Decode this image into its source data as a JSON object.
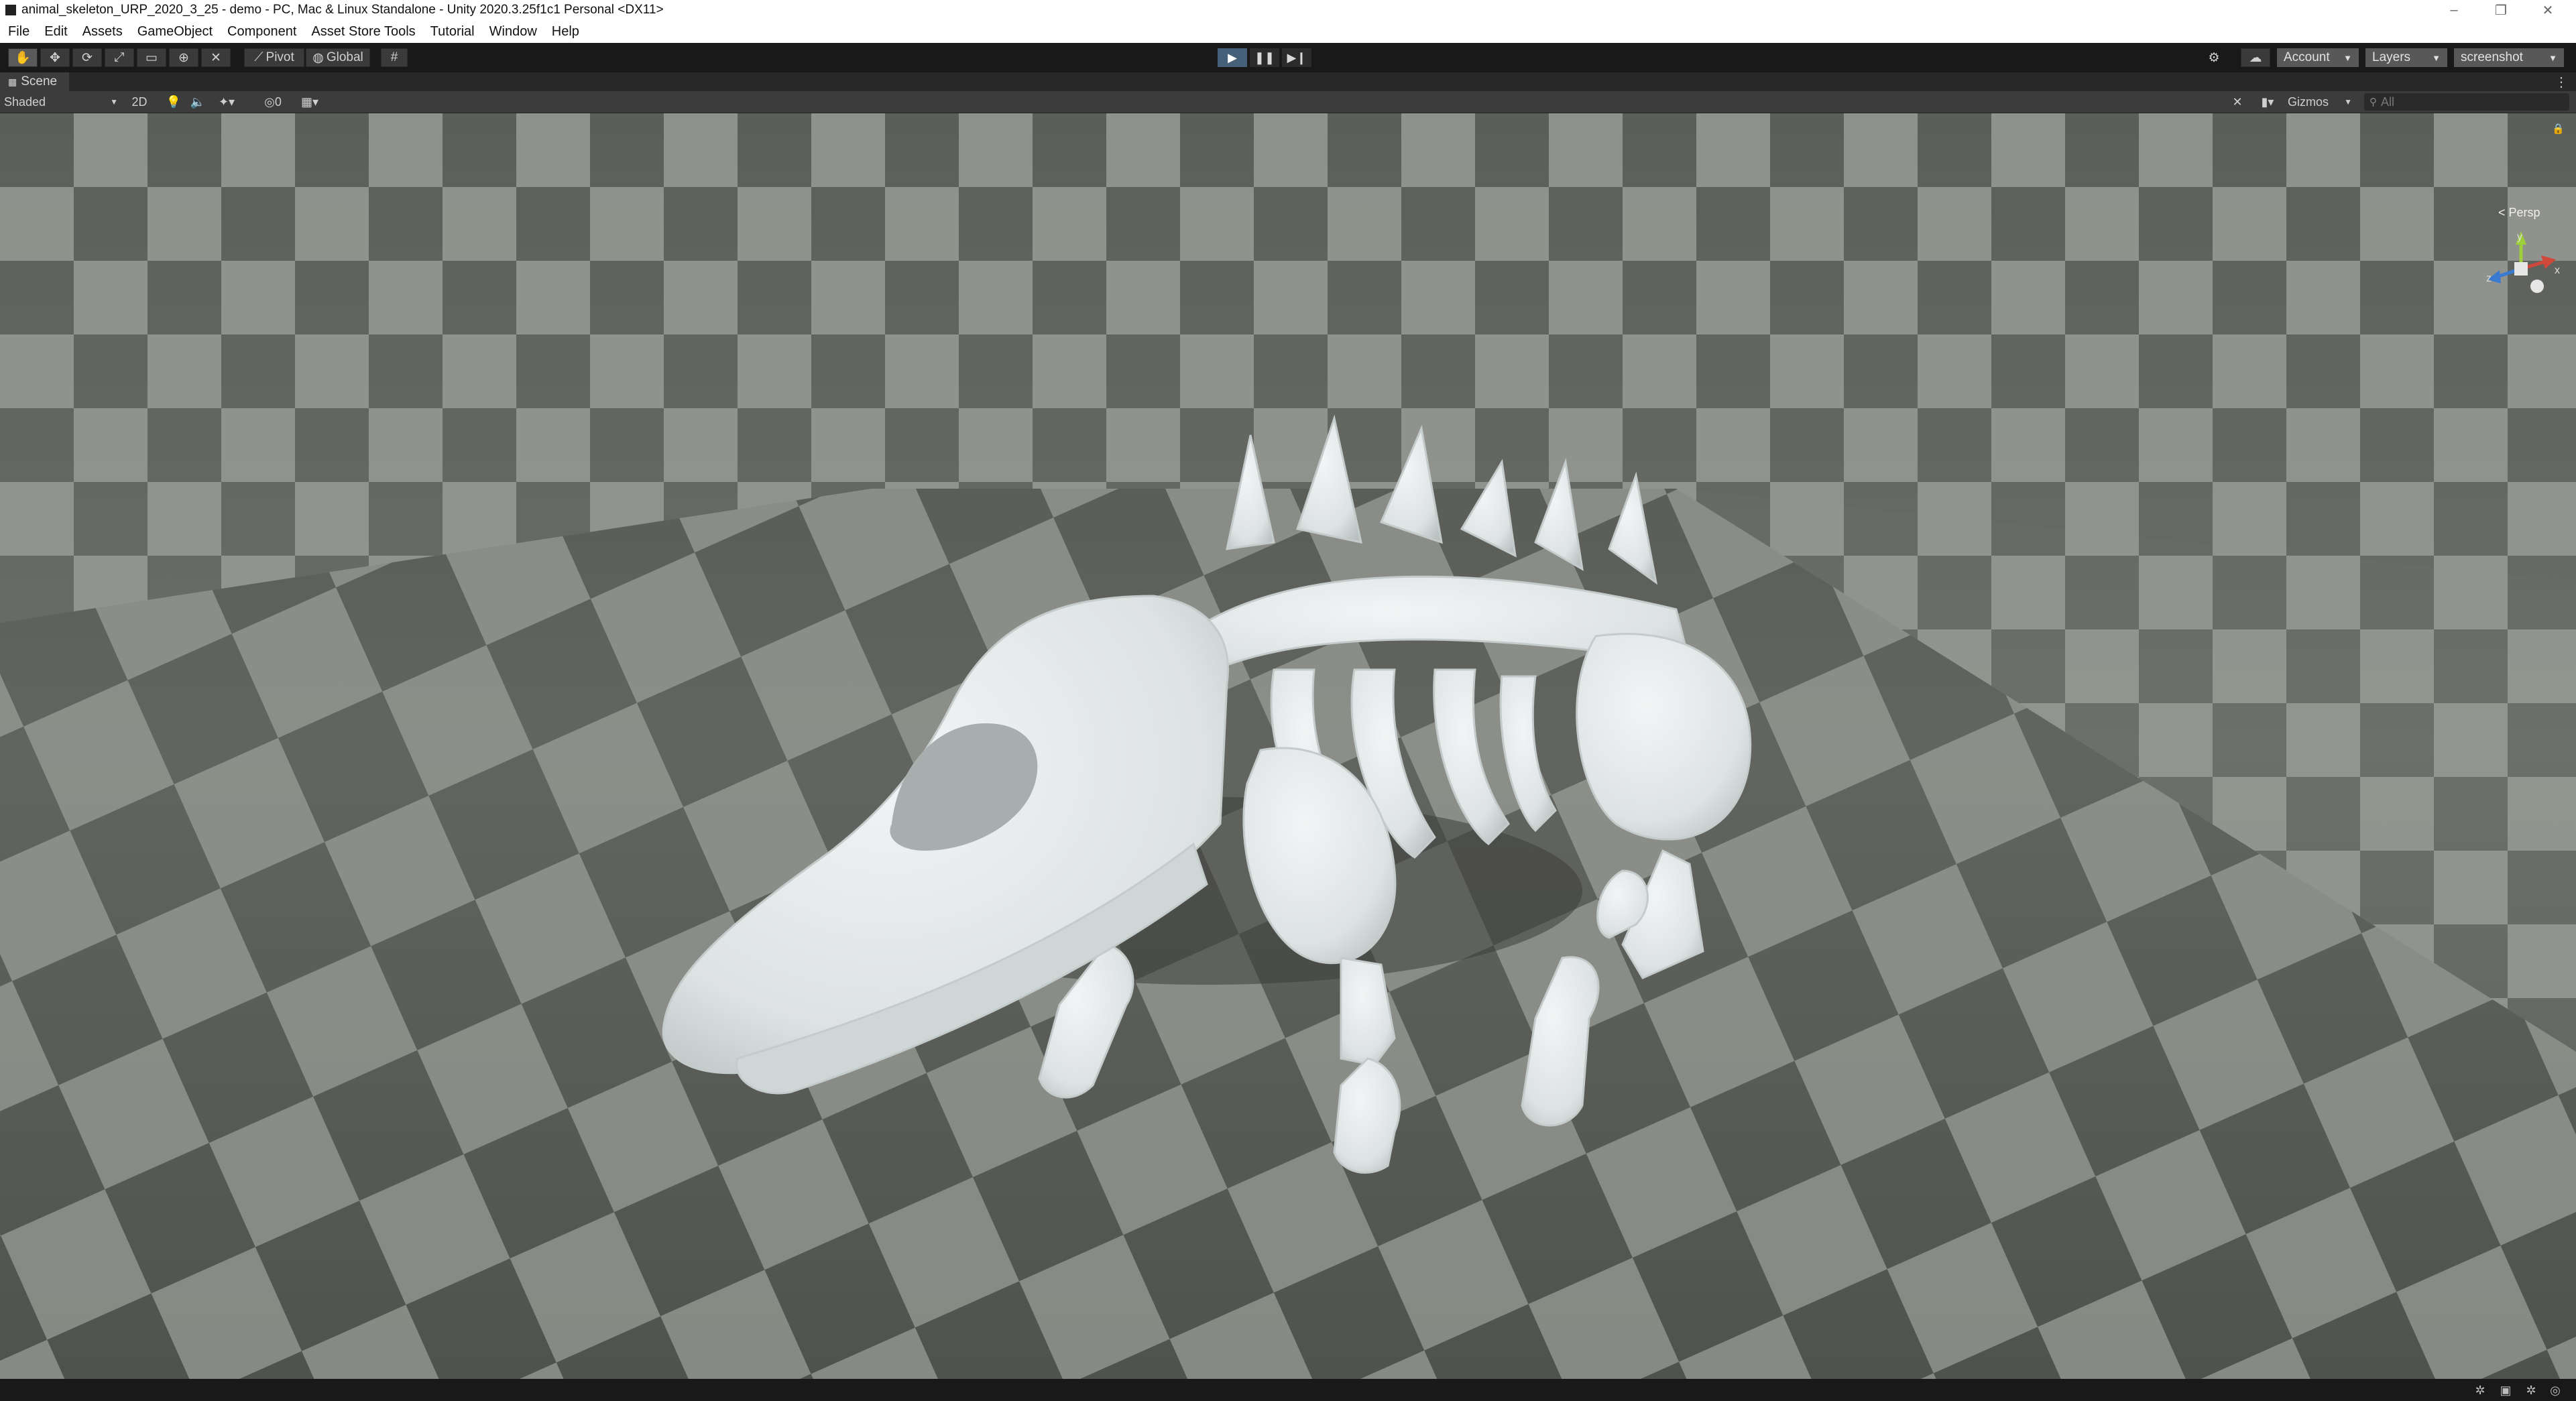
{
  "window": {
    "title": "animal_skeleton_URP_2020_3_25 - demo - PC, Mac & Linux Standalone - Unity 2020.3.25f1c1 Personal <DX11>",
    "controls": [
      "–",
      "❐",
      "✕"
    ]
  },
  "menubar": {
    "items": [
      "File",
      "Edit",
      "Assets",
      "GameObject",
      "Component",
      "Asset Store Tools",
      "Tutorial",
      "Window",
      "Help"
    ]
  },
  "toolbar": {
    "tools": [
      "hand-tool-icon",
      "move-tool-icon",
      "rotate-tool-icon",
      "scale-tool-icon",
      "rect-tool-icon",
      "transform-tool-icon",
      "custom-tool-icon"
    ],
    "pivot_label": "Pivot",
    "global_label": "Global",
    "play_icon": "▶",
    "pause_icon": "❚❚",
    "step_icon": "▶❙",
    "account_label": "Account",
    "layers_label": "Layers",
    "layout_label": "screenshot"
  },
  "scene_tab": {
    "label": "Scene"
  },
  "scene_toolbar": {
    "draw_mode": "Shaded",
    "mode_2d": "2D",
    "hidden_count": "0",
    "gizmos_label": "Gizmos",
    "search_placeholder": "All"
  },
  "viewport": {
    "persp_label": "< Persp",
    "gizmo_axes": {
      "y": "y",
      "x": "x",
      "z": "z"
    },
    "floor_colors": {
      "light": "#8f918c",
      "dark": "#5c5e5a"
    },
    "skeleton_color": "#e8ecec"
  }
}
